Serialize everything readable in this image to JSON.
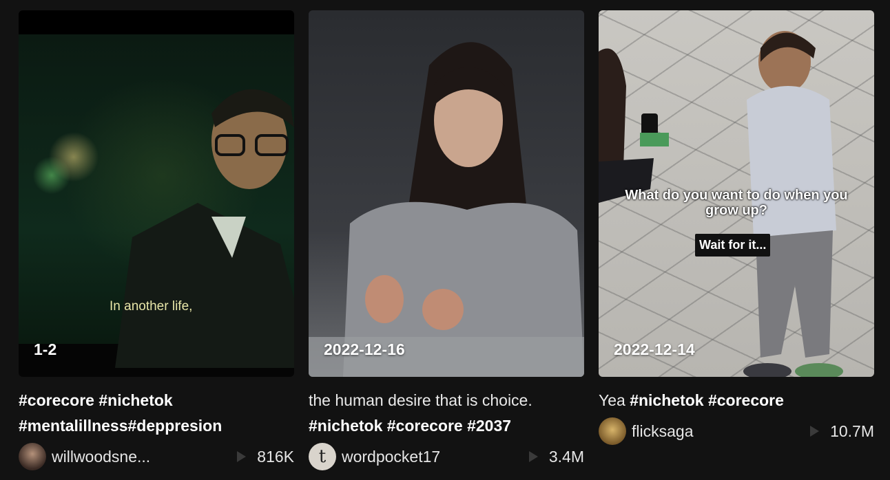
{
  "videos": [
    {
      "date": "1-2",
      "subtitle": "In another life,",
      "desc_line1": "#corecore #nichetok",
      "desc_line2": "#mentalillness#deppresion",
      "username": "willwoodsne...",
      "views": "816K",
      "avatar_icon": "user-photo-avatar"
    },
    {
      "date": "2022-12-16",
      "desc_line1": "the human desire that is choice.",
      "desc_line2": "#nichetok #corecore #2037",
      "username": "wordpocket17",
      "views": "3.4M",
      "avatar_letter": "t"
    },
    {
      "date": "2022-12-14",
      "overlay_question": "What do you want to do when you grow up?",
      "overlay_caption": "Wait for it...",
      "desc_prefix": "Yea ",
      "desc_tags": "#nichetok #corecore",
      "username": "flicksaga",
      "views": "10.7M",
      "avatar_icon": "shiba-avatar"
    }
  ],
  "colors": {
    "background": "#121212",
    "text": "#ffffff",
    "play_icon": "#3a3a3a"
  }
}
